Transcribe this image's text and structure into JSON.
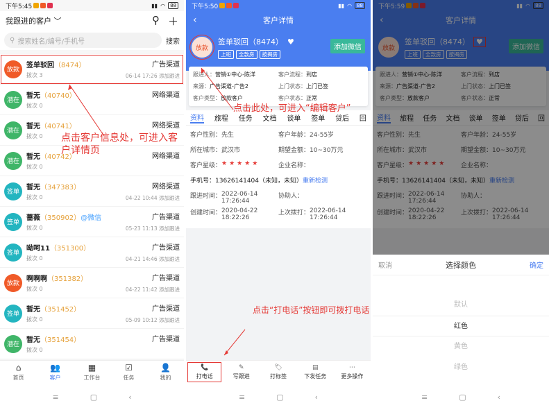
{
  "p1": {
    "time": "下午5:45",
    "batt": "88",
    "scope": "我跟进的客户",
    "search_placeholder": "搜索姓名/编号/手机号",
    "search_btn": "搜索",
    "items": [
      {
        "tag": "放款",
        "color": "#f05a28",
        "name": "签单驳回",
        "id": "（8474）",
        "sub": "拨次 3",
        "channel": "广告渠道",
        "time": "06-14 17:26 添加跟进"
      },
      {
        "tag": "潜在",
        "color": "#3fb568",
        "name": "暂无",
        "id": "（40740）",
        "sub": "拨次 0",
        "channel": "网络渠道",
        "time": ""
      },
      {
        "tag": "潜在",
        "color": "#3fb568",
        "name": "暂无",
        "id": "（40741）",
        "sub": "拨次 0",
        "channel": "网络渠道",
        "time": ""
      },
      {
        "tag": "潜在",
        "color": "#3fb568",
        "name": "暂无",
        "id": "（40742）",
        "sub": "拨次 0",
        "channel": "网络渠道",
        "time": ""
      },
      {
        "tag": "签单",
        "color": "#23b5c0",
        "name": "暂无",
        "id": "（347383）",
        "sub": "拨次 0",
        "channel": "网络渠道",
        "time": "04-22 10:44 添加跟进"
      },
      {
        "tag": "签单",
        "color": "#23b5c0",
        "name": "蔷薇",
        "id": "（350902）",
        "wx": "@微信",
        "sub": "拨次 0",
        "channel": "广告渠道",
        "time": "05-23 11:13 添加跟进"
      },
      {
        "tag": "签单",
        "color": "#23b5c0",
        "name": "呦呵11",
        "id": "（351300）",
        "sub": "拨次 0",
        "channel": "广告渠道",
        "time": "04-21 14:46 添加跟进"
      },
      {
        "tag": "放款",
        "color": "#f05a28",
        "name": "啊啊啊",
        "id": "（351382）",
        "sub": "拨次 0",
        "channel": "广告渠道",
        "time": "04-22 11:42 添加跟进"
      },
      {
        "tag": "签单",
        "color": "#23b5c0",
        "name": "暂无",
        "id": "（351452）",
        "sub": "拨次 0",
        "channel": "广告渠道",
        "time": "05-09 10:12 添加跟进"
      },
      {
        "tag": "潜在",
        "color": "#3fb568",
        "name": "暂无",
        "id": "（351454）",
        "sub": "拨次 0",
        "channel": "广告渠道",
        "time": ""
      }
    ],
    "tabs": [
      {
        "label": "首页",
        "icon": "⌂"
      },
      {
        "label": "客户",
        "icon": "👥"
      },
      {
        "label": "工作台",
        "icon": "▦"
      },
      {
        "label": "任务",
        "icon": "☑"
      },
      {
        "label": "我的",
        "icon": "👤"
      }
    ],
    "annotation": "点击客户信息处，可进入客户详情页"
  },
  "p2": {
    "time": "下午5:50",
    "batt": "88",
    "title": "客户详情",
    "tag": "放款",
    "name": "签单驳回（8474）",
    "tags": [
      "上班",
      "全款房",
      "按揭房"
    ],
    "addwx": "添加微信",
    "card": [
      [
        "跟进人：",
        "营销①中心-陈洋"
      ],
      [
        "客户流程：",
        "到店"
      ],
      [
        "来源：",
        "广告渠道-广告2"
      ],
      [
        "上门状态：",
        "上门已签"
      ],
      [
        "客户类型：",
        "放款客户"
      ],
      [
        "客户状态：",
        "正常"
      ]
    ],
    "tabs": [
      "资料",
      "旅程",
      "任务",
      "文档",
      "谈单",
      "签单",
      "贷后",
      "回"
    ],
    "gender_k": "客户性别：",
    "gender": "先生",
    "age_k": "客户年龄：",
    "age": "24-55岁",
    "city_k": "所在城市：",
    "city": "武汉市",
    "amount_k": "期望金额：",
    "amount": "10~30万元",
    "star_k": "客户星级：",
    "stars": "★★★★★",
    "company_k": "企业名称：",
    "phone_k": "手机号：",
    "phone": "13626141404（未知，未知）",
    "recheck": "重新检测",
    "follow_k": "跟进时间：",
    "follow": "2022-06-14 17:26:44",
    "helper_k": "协助人：",
    "create_k": "创建时间：",
    "create": "2020-04-22 18:22:26",
    "lastcall_k": "上次拨打：",
    "lastcall": "2022-06-14 17:26:44",
    "actions": [
      {
        "label": "打电话",
        "icon": "📞"
      },
      {
        "label": "写跟进",
        "icon": "✎"
      },
      {
        "label": "打标签",
        "icon": "🏷"
      },
      {
        "label": "下发任务",
        "icon": "▤"
      },
      {
        "label": "更多操作",
        "icon": "⋯"
      }
    ],
    "anno_edit": "点击此处，可进入“编辑客户”",
    "anno_call": "点击“打电话”按钮即可拨打电话"
  },
  "p3": {
    "time": "下午5:59",
    "batt": "88",
    "cancel": "取消",
    "title": "选择颜色",
    "ok": "确定",
    "opts": [
      "默认",
      "红色",
      "黄色",
      "绿色"
    ]
  }
}
